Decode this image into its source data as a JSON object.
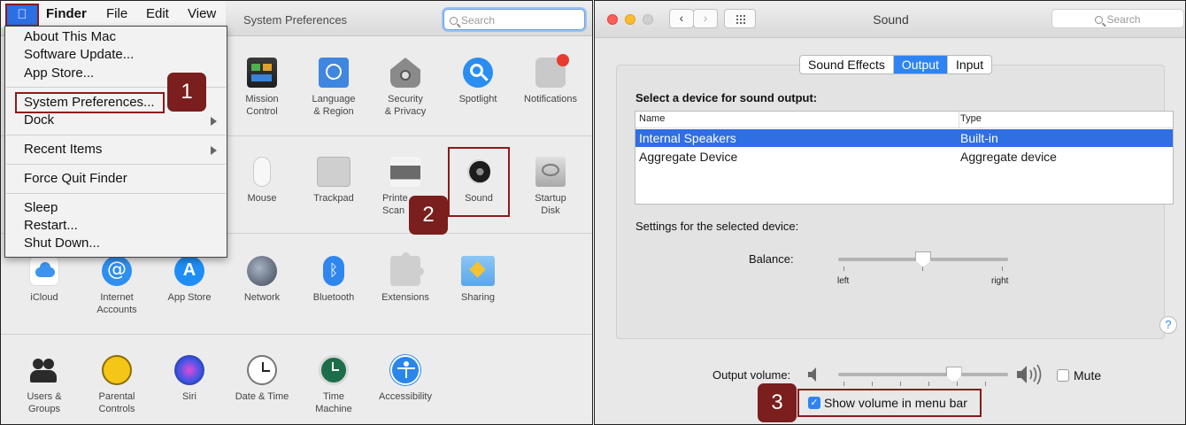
{
  "left": {
    "window_title": "System Preferences",
    "search_placeholder": "Search",
    "menubar": {
      "apple_icon": "apple-logo-icon",
      "items": [
        "Finder",
        "File",
        "Edit",
        "View"
      ]
    },
    "apple_menu": {
      "items": [
        "About This Mac",
        "Software Update...",
        "App Store...",
        "System Preferences...",
        "Dock",
        "Recent Items",
        "Force Quit Finder",
        "Sleep",
        "Restart...",
        "Shut Down..."
      ]
    },
    "row1": [
      {
        "label": "Mission\nControl",
        "icon": "mission-control-icon"
      },
      {
        "label": "Language\n& Region",
        "icon": "globe-flag-icon"
      },
      {
        "label": "Security\n& Privacy",
        "icon": "house-lock-icon"
      },
      {
        "label": "Spotlight",
        "icon": "magnifier-icon"
      },
      {
        "label": "Notifications",
        "icon": "notifications-icon"
      }
    ],
    "row2": [
      {
        "label": "Mouse",
        "icon": "mouse-icon"
      },
      {
        "label": "Trackpad",
        "icon": "trackpad-icon"
      },
      {
        "label": "Printe\nScan",
        "icon": "printer-icon"
      },
      {
        "label": "Sound",
        "icon": "speaker-icon"
      },
      {
        "label": "Startup\nDisk",
        "icon": "disk-icon"
      }
    ],
    "row3": [
      {
        "label": "iCloud",
        "icon": "cloud-icon"
      },
      {
        "label": "Internet\nAccounts",
        "icon": "at-sign-icon"
      },
      {
        "label": "App Store",
        "icon": "app-store-icon"
      },
      {
        "label": "Network",
        "icon": "network-globe-icon"
      },
      {
        "label": "Bluetooth",
        "icon": "bluetooth-icon"
      },
      {
        "label": "Extensions",
        "icon": "puzzle-icon"
      },
      {
        "label": "Sharing",
        "icon": "sharing-folder-icon"
      }
    ],
    "row4": [
      {
        "label": "Users &\nGroups",
        "icon": "users-icon"
      },
      {
        "label": "Parental\nControls",
        "icon": "parental-icon"
      },
      {
        "label": "Siri",
        "icon": "siri-icon"
      },
      {
        "label": "Date & Time",
        "icon": "clock-icon"
      },
      {
        "label": "Time\nMachine",
        "icon": "time-machine-icon"
      },
      {
        "label": "Accessibility",
        "icon": "accessibility-icon"
      }
    ],
    "badges": [
      "1",
      "2"
    ]
  },
  "right": {
    "window_title": "Sound",
    "search_placeholder": "Search",
    "tabs": [
      "Sound Effects",
      "Output",
      "Input"
    ],
    "active_tab": "Output",
    "device_heading": "Select a device for sound output:",
    "table": {
      "headers": [
        "Name",
        "Type"
      ],
      "rows": [
        {
          "name": "Internal Speakers",
          "type": "Built-in",
          "selected": true
        },
        {
          "name": "Aggregate Device",
          "type": "Aggregate device",
          "selected": false
        }
      ]
    },
    "settings_label": "Settings for the selected device:",
    "balance": {
      "label": "Balance:",
      "left": "left",
      "right": "right",
      "value": 0.5
    },
    "output_volume": {
      "label": "Output volume:",
      "value": 0.68
    },
    "mute_label": "Mute",
    "mute_checked": false,
    "show_volume_label": "Show volume in menu bar",
    "show_volume_checked": true,
    "help": "?",
    "badge": "3"
  },
  "colors": {
    "accent": "#2f84f2",
    "annotation": "#8b1a1a",
    "badge_bg": "#7a1e1e"
  }
}
